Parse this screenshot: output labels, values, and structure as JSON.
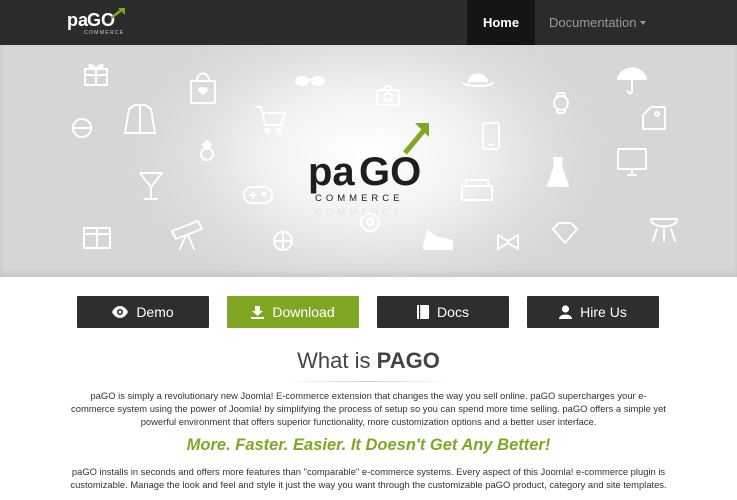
{
  "brand": {
    "name_pa": "pa",
    "name_go": "GO",
    "sub": "COMMERCE",
    "accent_color": "#80a724"
  },
  "nav": {
    "items": [
      {
        "label": "Home",
        "active": true
      },
      {
        "label": "Documentation",
        "dropdown": true
      }
    ]
  },
  "hero": {
    "background_icons": [
      "gift-icon",
      "shopping-bag-icon",
      "hat-icon",
      "umbrella-icon",
      "sunglasses-icon",
      "jacket-icon",
      "shopping-cart-icon",
      "diamond-ring-icon",
      "cocktail-icon",
      "telescope-icon",
      "game-controller-icon",
      "basketball-icon",
      "cd-icon",
      "shoe-icon",
      "bow-tie-icon",
      "camera-icon",
      "phone-icon",
      "couch-icon",
      "dress-icon",
      "monitor-icon",
      "barbecue-icon",
      "watch-icon",
      "price-tag-icon"
    ]
  },
  "buttons": [
    {
      "label": "Demo",
      "icon": "eye-icon"
    },
    {
      "label": "Download",
      "icon": "download-icon"
    },
    {
      "label": "Docs",
      "icon": "book-icon"
    },
    {
      "label": "Hire Us",
      "icon": "user-icon"
    }
  ],
  "content": {
    "title_prefix": "What is",
    "title_bold": "PAGO",
    "paragraph1": "paGO is simply a revolutionary new Joomla! E-commerce extension that changes the way you sell online. paGO supercharges your e-commerce system using the power of Joomla! by simplifying the process of setup so you can spend more time selling. paGO offers a simple yet powerful environment that offers superior functionality, more customization options and a better user interface.",
    "tagline": "More. Faster. Easier. It Doesn't Get Any Better!",
    "paragraph2": "paGO installs in seconds and offers more features than \"comparable\" e-commerce systems. Every aspect of this Joomla! e-commerce plugin is customizable. Manage the look and feel and style it just the way you want through the customizable paGO product, category and site templates."
  }
}
